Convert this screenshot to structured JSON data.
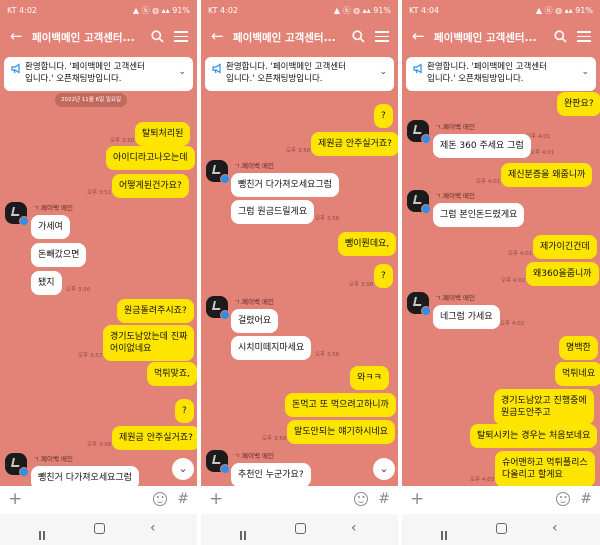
{
  "panels": [
    {
      "status": {
        "carrier_time": "KT 4:02",
        "sys": "▲ ⓑ ◍ ▴▴ 91%"
      },
      "title": "페이백메인 고객센터...",
      "notice": [
        "환영합니다. '페이백메인 고객센터",
        "입니다.' 오픈채팅방입니다."
      ],
      "date": "2022년 11월 6일 일요일",
      "show_scroll_down": true,
      "messages": [
        {
          "side": "me",
          "text": "탈퇴처리된",
          "time": "오후 3:50"
        },
        {
          "side": "me",
          "text": "아이디라고나오는데"
        },
        {
          "side": "me",
          "text": "어떻게된건가요?",
          "time": "오후 3:51"
        },
        {
          "side": "them",
          "sender": "ㄱ.페이백 메인",
          "lines": [
            "가세여"
          ]
        },
        {
          "side": "them",
          "lines": [
            "돈빼갔으면"
          ]
        },
        {
          "side": "them",
          "lines": [
            "됐지"
          ],
          "time": "오후 3:56"
        },
        {
          "side": "me",
          "text": "원금돌려주시죠?"
        },
        {
          "side": "me",
          "lines": [
            "경기도남았는데 진짜",
            "어이없네요"
          ],
          "time": "오후 3:57"
        },
        {
          "side": "me",
          "text": "먹튀맞죠,"
        },
        {
          "side": "me",
          "text": "?"
        },
        {
          "side": "me",
          "text": "제원금 안주실거죠?",
          "time": "오후 3:58"
        },
        {
          "side": "them",
          "sender": "ㄱ.페이백 메인",
          "lines": [
            "뺑친거 다가져오세요그럼"
          ]
        }
      ]
    },
    {
      "status": {
        "carrier_time": "KT 4:02",
        "sys": "▲ ⓑ ◍ ▴▴ 91%"
      },
      "title": "페이백메인 고객센터...",
      "notice": [
        "환영합니다. '페이백메인 고객센터",
        "입니다.' 오픈채팅방입니다."
      ],
      "date": "",
      "show_scroll_down": true,
      "messages": [
        {
          "side": "me",
          "text": "?"
        },
        {
          "side": "me",
          "text": "제원금 안주실거죠?",
          "time": "오후 3:58"
        },
        {
          "side": "them",
          "sender": "ㄱ.페이백 메인",
          "lines": [
            "뺑친거 다가져오세요그럼"
          ]
        },
        {
          "side": "them",
          "lines": [
            "그럼 원금드릴게요"
          ],
          "time": "오후 3:58"
        },
        {
          "side": "me",
          "text": "뺑이뭔데요,"
        },
        {
          "side": "me",
          "text": "?",
          "time": "오후 3:58"
        },
        {
          "side": "them",
          "sender": "ㄱ.페이백 메인",
          "lines": [
            "걸렸어요"
          ]
        },
        {
          "side": "them",
          "lines": [
            "시치미떼지마세요"
          ],
          "time": "오후 3:58"
        },
        {
          "side": "me",
          "text": "와ㅋㅋ"
        },
        {
          "side": "me",
          "text": "돈먹고 또 먹으려고하니까"
        },
        {
          "side": "me",
          "text": "말도안되는 얘기하시네요",
          "time": "오후 3:59"
        },
        {
          "side": "them",
          "sender": "ㄱ.페이백 메인",
          "lines": [
            "추천인 누군가요?"
          ]
        }
      ]
    },
    {
      "status": {
        "carrier_time": "KT 4:04",
        "sys": "▲ ⓑ ◍ ▴▴ 91%"
      },
      "title": "페이백메인 고객센터...",
      "notice": [
        "환영합니다. '페이백메인 고객센터",
        "입니다.' 오픈채팅방입니다."
      ],
      "date": "",
      "show_scroll_down": false,
      "messages": [
        {
          "side": "me",
          "text": "완판요?",
          "time": "오후 4:01"
        },
        {
          "side": "them",
          "sender": "ㄱ.페이백 메인",
          "lines": [
            "제돈 360 주세요 그럼"
          ],
          "time": "오후 4:01"
        },
        {
          "side": "me",
          "text": "제신분증을 왜줍니까",
          "time": "오후 4:01"
        },
        {
          "side": "them",
          "sender": "ㄱ.페이백 메인",
          "lines": [
            "그럼 본인돈드렸게요"
          ]
        },
        {
          "side": "me",
          "text": "제가이긴건데",
          "time": "오후 4:01"
        },
        {
          "side": "me",
          "text": "왜360을줍니까",
          "time": "오후 4:02"
        },
        {
          "side": "them",
          "sender": "ㄱ.페이백 메인",
          "lines": [
            "네그럼 가세요"
          ],
          "time": "오후 4:02"
        },
        {
          "side": "me",
          "text": "명백한"
        },
        {
          "side": "me",
          "text": "먹튀네요"
        },
        {
          "side": "me",
          "lines": [
            "경기도남았고 진행중에",
            "원금도안주고"
          ]
        },
        {
          "side": "me",
          "text": "탈퇴시키는 경우는 처음보네요"
        },
        {
          "side": "me",
          "lines": [
            "슈어맨하고 먹튀폴리스",
            "다올리고 할게요"
          ],
          "time": "오후 4:03"
        }
      ]
    }
  ],
  "colors": {
    "background": "#E38377",
    "my_bubble": "#FEE500",
    "their_bubble": "#FFFFFF",
    "accent": "#2F8EE8"
  },
  "icons": [
    "back-arrow-icon",
    "search-icon",
    "menu-icon",
    "megaphone-icon",
    "chevron-down-icon",
    "plus-icon",
    "emoji-icon",
    "hash-icon",
    "recents-icon",
    "home-icon",
    "back-icon"
  ],
  "input": {
    "plus": "+",
    "hash": "#"
  },
  "nav": {
    "back": "‹"
  }
}
